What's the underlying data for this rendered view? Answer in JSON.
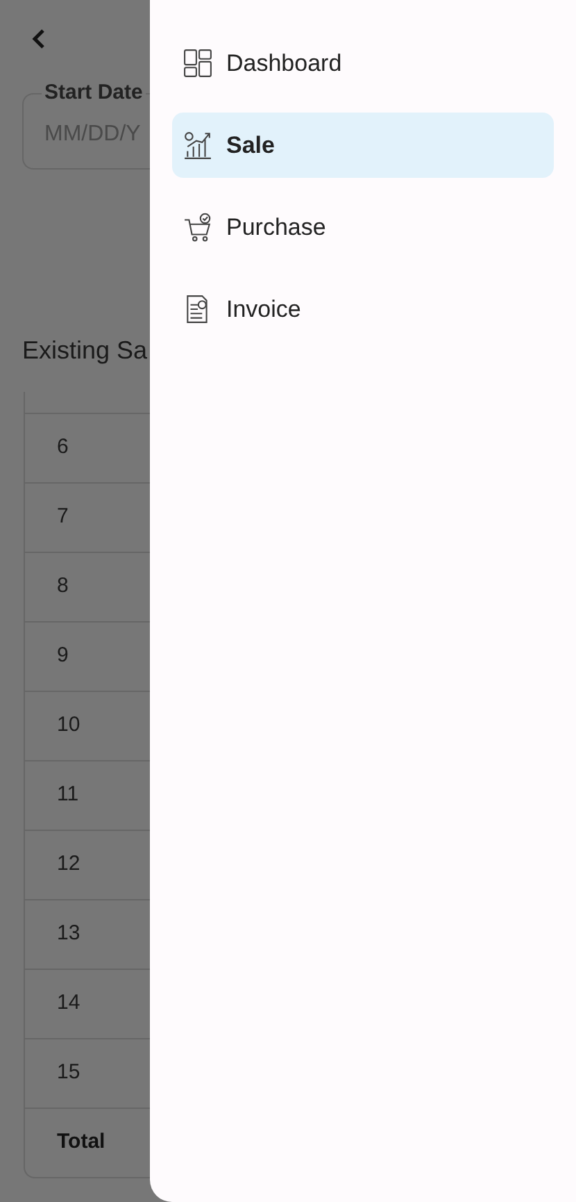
{
  "page": {
    "date_field": {
      "label": "Start Date",
      "placeholder": "MM/DD/Y"
    },
    "heading": "Existing Sa",
    "table": {
      "rows": [
        {
          "cell": "6"
        },
        {
          "cell": "7"
        },
        {
          "cell": "8"
        },
        {
          "cell": "9"
        },
        {
          "cell": "10"
        },
        {
          "cell": "11"
        },
        {
          "cell": "12"
        },
        {
          "cell": "13"
        },
        {
          "cell": "14"
        },
        {
          "cell": "15"
        }
      ],
      "total": "Total"
    }
  },
  "drawer": {
    "items": [
      {
        "kind": "dashboard",
        "label": "Dashboard",
        "selected": false
      },
      {
        "kind": "sale",
        "label": "Sale",
        "selected": true
      },
      {
        "kind": "purchase",
        "label": "Purchase",
        "selected": false
      },
      {
        "kind": "invoice",
        "label": "Invoice",
        "selected": false
      }
    ]
  }
}
